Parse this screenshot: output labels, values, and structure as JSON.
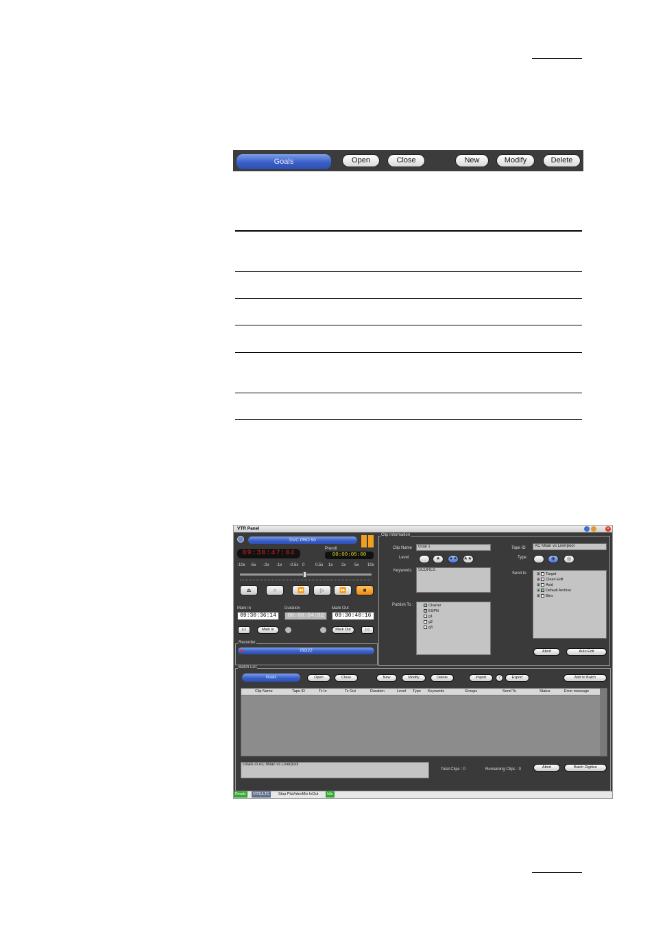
{
  "toolbar": {
    "goals": "Goals",
    "open": "Open",
    "close": "Close",
    "new": "New",
    "modify": "Modify",
    "delete": "Delete"
  },
  "vtr": {
    "title": "VTR Panel",
    "format": "DVC PRO 50",
    "timecode": "09:30:47:04",
    "preroll_label": "Preroll",
    "preroll": "00:00:05:00",
    "speeds": [
      "-10x",
      "-5x",
      "-2x",
      "-1x",
      "-0.5x",
      "0",
      "0.5x",
      "1x",
      "2x",
      "5x",
      "10x"
    ],
    "mark_in_label": "Mark In",
    "mark_in": "09:30:36:14",
    "duration_label": "Duration",
    "duration": "00:00:04:02",
    "mark_out_label": "Mark Out",
    "mark_out": "09:30:40:16",
    "mark_in_btn": "Mark In",
    "mark_out_btn": "Mark Out",
    "recorder_label": "Recorder",
    "recorder": "ISO22",
    "clip_info_label": "Clip Information",
    "clip_name_label": "Clip Name",
    "clip_name": "Goal 1",
    "level_label": "Level",
    "keywords_label": "Keywords",
    "keywords": "SCORES",
    "publish_label": "Publish To :",
    "publish": [
      {
        "name": "Charter",
        "checked": true
      },
      {
        "name": "ESPN",
        "checked": true
      },
      {
        "name": "g1",
        "checked": false
      },
      {
        "name": "g2",
        "checked": false
      },
      {
        "name": "g3",
        "checked": false
      }
    ],
    "tape_id_label": "Tape ID",
    "tape_id": "AC Milan vs Liverpool",
    "type_label": "Type",
    "send_to_label": "Send to",
    "send_to": [
      "Target",
      "Clean Edit",
      "Avid",
      "Default Archive",
      "Bins"
    ],
    "abort": "Abort",
    "auto_edit": "Auto Edit",
    "batch_label": "Batch List",
    "batch_btns": {
      "goals": "Goals",
      "open": "Open",
      "close": "Close",
      "new": "New",
      "modify": "Modify",
      "delete": "Delete",
      "import": "Import",
      "help": "?",
      "export": "Export",
      "add": "Add to Batch"
    },
    "columns": [
      "Clip Name",
      "Tape ID",
      "Tc In",
      "Tc Out",
      "Duration",
      "Level",
      "Type",
      "Keywords",
      "Groups",
      "Send To",
      "Status",
      "Error message"
    ],
    "description": "Goals in AC Milan vs Liverpool",
    "total_clips": "Total Clips : 0",
    "remaining": "Remaining Clips : 0",
    "abort2": "Abort",
    "batch_digitize": "Batch Digitize",
    "status": {
      "ready": "Ready",
      "vitc": "VITC/LTC",
      "stop": "Stop PlaVideoMix InOut",
      "idle": "Idle"
    }
  },
  "colors": {
    "accent": "#3a5fc8",
    "window": "#3a3a3a",
    "timecode_red": "#e02020",
    "preroll_yellow": "#f0e020",
    "status_green": "#2fa82f"
  }
}
